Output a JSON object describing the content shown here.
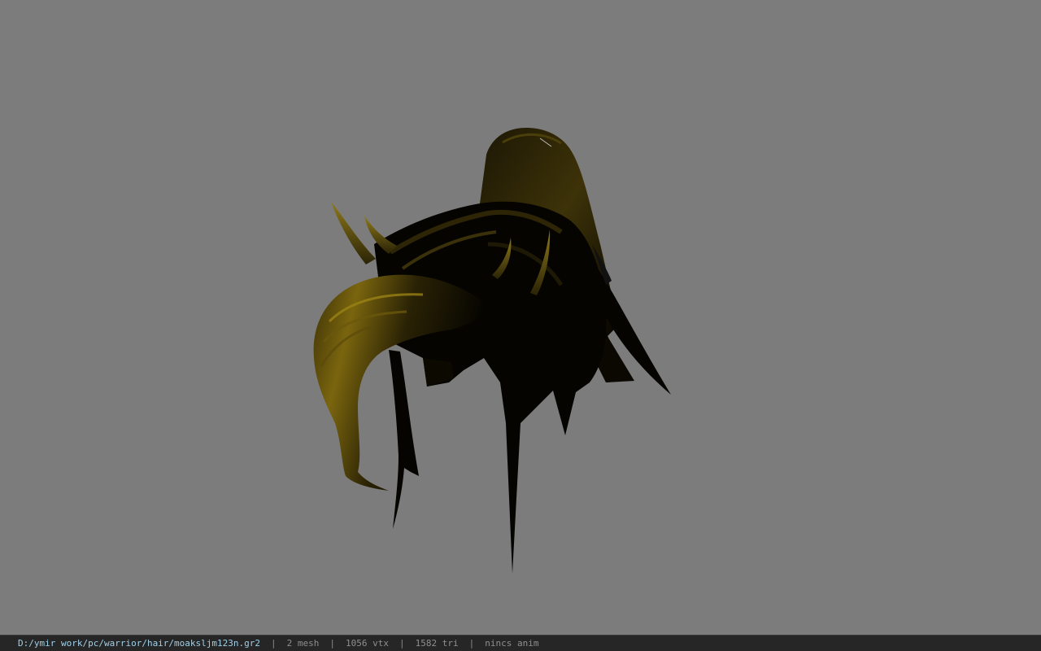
{
  "viewer": {
    "background_color": "#7c7c7c",
    "model_colors": {
      "shadow": "#000000",
      "dark_strand": "#1a1607",
      "mid_strand": "#4a3d08",
      "highlight": "#8a7410"
    },
    "model_description_icon": "hair-mesh"
  },
  "status_bar": {
    "path": "D:/ymir work/pc/warrior/hair/moaksljm123n.gr2",
    "separator": "|",
    "mesh": "2 mesh",
    "vertices": "1056 vtx",
    "triangles": "1582 tri",
    "anim": "nincs anim"
  }
}
